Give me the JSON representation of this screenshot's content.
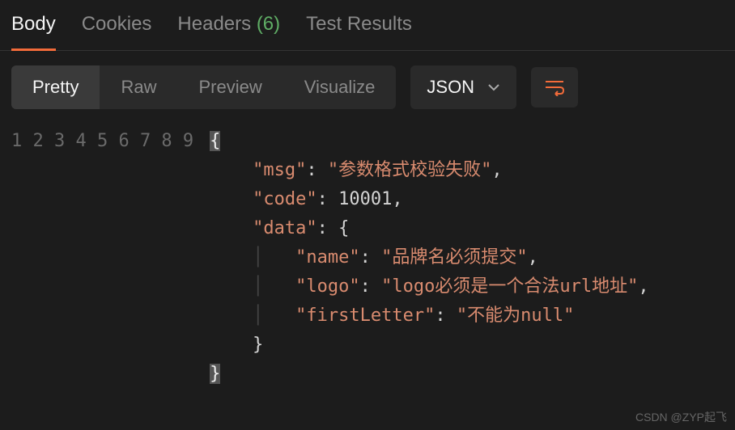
{
  "primaryTabs": {
    "body": "Body",
    "cookies": "Cookies",
    "headers": "Headers",
    "headersCount": "(6)",
    "testResults": "Test Results"
  },
  "viewTabs": {
    "pretty": "Pretty",
    "raw": "Raw",
    "preview": "Preview",
    "visualize": "Visualize"
  },
  "formatSelect": {
    "label": "JSON"
  },
  "code": {
    "lines": [
      "1",
      "2",
      "3",
      "4",
      "5",
      "6",
      "7",
      "8",
      "9"
    ],
    "brace_open": "{",
    "brace_close": "}",
    "nested_brace_close": "}",
    "msg_key": "\"msg\"",
    "msg_val": "\"参数格式校验失败\"",
    "code_key": "\"code\"",
    "code_val": "10001",
    "data_key": "\"data\"",
    "data_open": "{",
    "name_key": "\"name\"",
    "name_val": "\"品牌名必须提交\"",
    "logo_key": "\"logo\"",
    "logo_val": "\"logo必须是一个合法url地址\"",
    "firstLetter_key": "\"firstLetter\"",
    "firstLetter_val": "\"不能为null\"",
    "colon_sp": ": ",
    "comma": ","
  },
  "watermark": "CSDN @ZYP起飞"
}
